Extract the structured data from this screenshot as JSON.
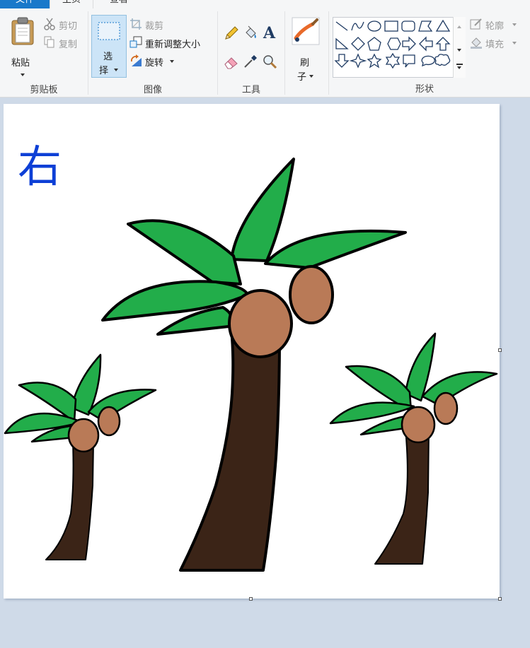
{
  "tabs": {
    "file": "文件",
    "home": "主页",
    "view": "查看"
  },
  "clipboard": {
    "paste": "粘贴",
    "cut": "剪切",
    "copy": "复制",
    "label": "剪贴板"
  },
  "image": {
    "select_line1": "选",
    "select_line2": "择",
    "crop": "裁剪",
    "resize": "重新调整大小",
    "rotate": "旋转",
    "label": "图像"
  },
  "tools": {
    "label": "工具",
    "text_glyph": "A"
  },
  "brushes": {
    "line1": "刷",
    "line2": "子"
  },
  "shapes": {
    "label": "形状",
    "outline": "轮廓",
    "fill": "填充"
  },
  "canvas": {
    "handwriting": "右"
  },
  "colors": {
    "accent": "#1979ca",
    "leaf_green": "#22ad4a",
    "trunk_brown": "#3b2417",
    "coconut": "#b97a57",
    "pen_blue": "#0d3fd6",
    "workspace_bg": "#cfdae8"
  }
}
